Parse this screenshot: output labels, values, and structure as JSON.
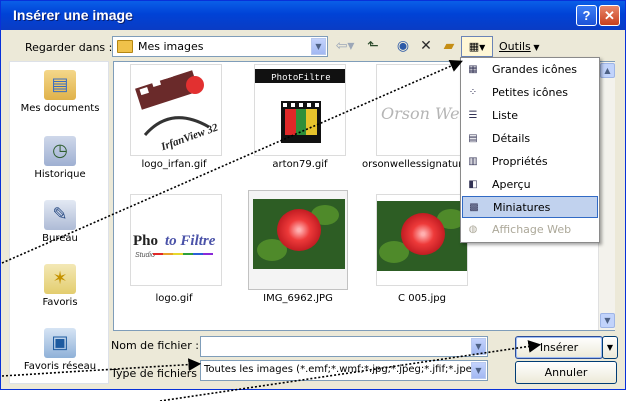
{
  "window": {
    "title": "Insérer une image"
  },
  "toolbar": {
    "look_in_label": "Regarder dans :",
    "look_in_value": "Mes images",
    "tools_label": "Outils"
  },
  "places": [
    {
      "label": "Mes documents",
      "icon": "folder-documents-icon"
    },
    {
      "label": "Historique",
      "icon": "history-icon"
    },
    {
      "label": "Bureau",
      "icon": "desktop-icon"
    },
    {
      "label": "Favoris",
      "icon": "favorites-icon"
    },
    {
      "label": "Favoris réseau",
      "icon": "network-places-icon"
    }
  ],
  "files": [
    {
      "name": "logo_irfan.gif"
    },
    {
      "name": "arton79.gif"
    },
    {
      "name": "orsonwellessignature"
    },
    {
      "name": "logo.gif"
    },
    {
      "name": "IMG_6962.JPG"
    },
    {
      "name": "C 005.jpg"
    }
  ],
  "thumb_text": {
    "irfan": "IrfanView 32",
    "photofiltre_banner": "PhotoFiltre",
    "photo": "Pho",
    "to_filtre": "to Filtre",
    "studio": "Studio",
    "signature": "Orson Welles"
  },
  "view_menu": {
    "items": [
      {
        "label": "Grandes icônes",
        "state": "normal"
      },
      {
        "label": "Petites icônes",
        "state": "normal"
      },
      {
        "label": "Liste",
        "state": "normal"
      },
      {
        "label": "Détails",
        "state": "normal"
      },
      {
        "label": "Propriétés",
        "state": "normal"
      },
      {
        "label": "Aperçu",
        "state": "normal"
      },
      {
        "label": "Miniatures",
        "state": "highlighted"
      },
      {
        "label": "Affichage Web",
        "state": "disabled"
      }
    ]
  },
  "bottom": {
    "filename_label": "Nom de fichier :",
    "filename_value": "",
    "filetype_label": "Type de fichiers :",
    "filetype_value": "Toutes les images (*.emf;*.wmf;*.jpg;*.jpeg;*.jfif;*.jpe",
    "insert_label": "Insérer",
    "cancel_label": "Annuler"
  },
  "colors": {
    "title_bar": "#0a5fe8",
    "dialog_face": "#ece9d8",
    "menu_highlight": "#c1d2ee",
    "rose": "#ee3a3a"
  }
}
